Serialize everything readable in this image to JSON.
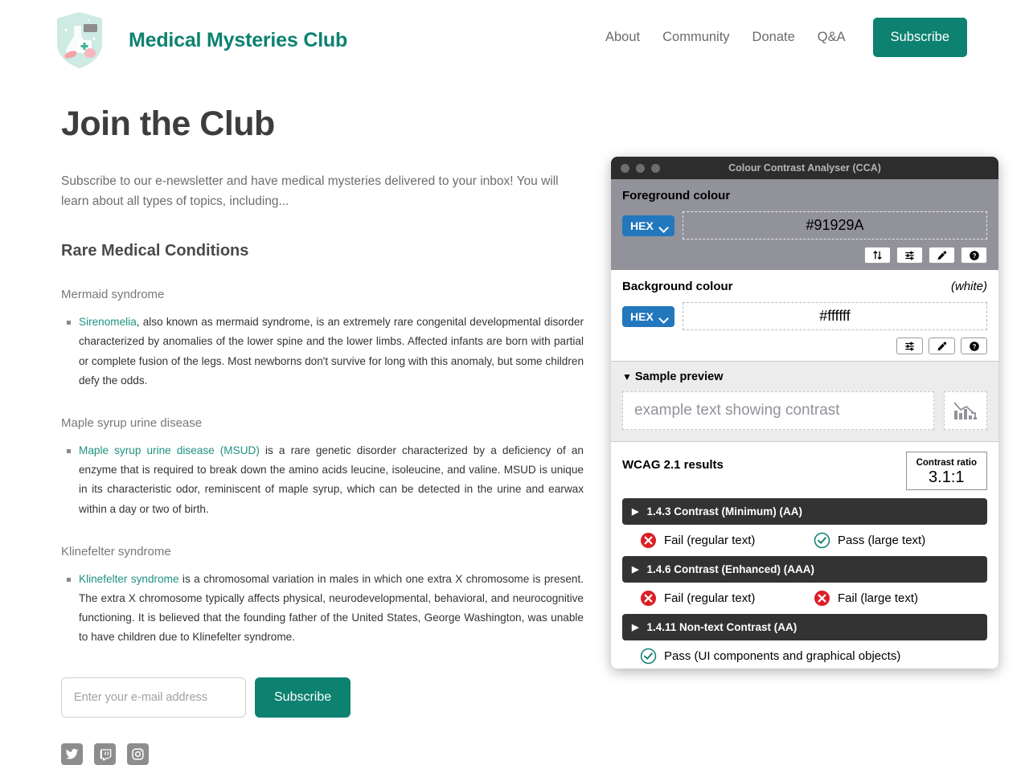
{
  "header": {
    "logo_icon": "shield-science-logo",
    "brand": "Medical Mysteries Club",
    "nav": [
      {
        "label": "About"
      },
      {
        "label": "Community"
      },
      {
        "label": "Donate"
      },
      {
        "label": "Q&A"
      }
    ],
    "subscribe_button": "Subscribe",
    "accent_color": "#0d8271"
  },
  "main": {
    "title": "Join the Club",
    "intro": "Subscribe to our e-newsletter and have medical mysteries delivered to your inbox! You will learn about all types of topics, including...",
    "section_heading": "Rare Medical Conditions",
    "conditions": [
      {
        "title": "Mermaid syndrome",
        "link_text": "Sirenomelia",
        "body": ", also known as mermaid syndrome, is an extremely rare congenital developmental disorder characterized by anomalies of the lower spine and the lower limbs. Affected infants are born with partial or complete fusion of the legs. Most newborns don't survive for long with this anomaly, but some children defy the odds."
      },
      {
        "title": "Maple syrup urine disease",
        "link_text": "Maple syrup urine disease (MSUD)",
        "body": " is a rare genetic disorder characterized by a deficiency of an enzyme that is required to break down the amino acids leucine, isoleucine, and valine. MSUD is unique in its characteristic odor, reminiscent of maple syrup, which can be detected in the urine and earwax within a day or two of birth."
      },
      {
        "title": "Klinefelter syndrome",
        "link_text": "Klinefelter syndrome",
        "body": " is a chromosomal variation in males in which one extra X chromosome is present. The extra X chromosome typically affects physical, neurodevelopmental, behavioral, and neurocognitive functioning. It is believed that the founding father of the United States, George Washington, was unable to have children due to Klinefelter syndrome."
      }
    ],
    "link_color": "#1e9180"
  },
  "subscribe_form": {
    "email_placeholder": "Enter your e-mail address",
    "email_value": "",
    "button_label": "Subscribe"
  },
  "social": [
    {
      "name": "twitter-icon"
    },
    {
      "name": "twitch-icon"
    },
    {
      "name": "instagram-icon"
    }
  ],
  "cca": {
    "window_title": "Colour Contrast Analyser (CCA)",
    "foreground": {
      "label": "Foreground colour",
      "format": "HEX",
      "value": "#91929A",
      "buttons": [
        "swap-icon",
        "sliders-icon",
        "eyedropper-icon",
        "help-icon"
      ]
    },
    "background": {
      "label": "Background colour",
      "note": "(white)",
      "format": "HEX",
      "value": "#ffffff",
      "buttons": [
        "sliders-icon",
        "eyedropper-icon",
        "help-icon"
      ]
    },
    "preview": {
      "heading": "Sample preview",
      "sample_text": "example text showing contrast",
      "graphic_icon": "bar-chart-declining-icon"
    },
    "results": {
      "title": "WCAG 2.1 results",
      "ratio_label": "Contrast ratio",
      "ratio_value": "3.1:1",
      "criteria": [
        {
          "label": "1.4.3 Contrast (Minimum) (AA)",
          "verdicts": [
            {
              "status": "fail",
              "text": "Fail (regular text)"
            },
            {
              "status": "pass",
              "text": "Pass (large text)"
            }
          ]
        },
        {
          "label": "1.4.6 Contrast (Enhanced) (AAA)",
          "verdicts": [
            {
              "status": "fail",
              "text": "Fail (regular text)"
            },
            {
              "status": "fail",
              "text": "Fail (large text)"
            }
          ]
        },
        {
          "label": "1.4.11 Non-text Contrast (AA)",
          "verdicts": [
            {
              "status": "pass",
              "text": "Pass (UI components and graphical objects)"
            }
          ]
        }
      ]
    },
    "colors": {
      "fail": "#dc1f26",
      "pass": "#0d8271",
      "select": "#2377bd",
      "criterion_bar": "#333333",
      "fg_panel": "#91929a"
    }
  }
}
